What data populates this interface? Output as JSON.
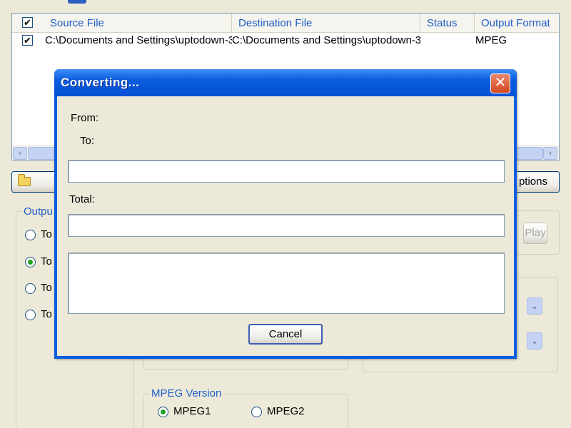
{
  "file_list": {
    "headers": [
      "Source File",
      "Destination File",
      "Status",
      "Output Format"
    ],
    "rows": [
      {
        "checked": true,
        "source": "C:\\Documents and Settings\\uptodown-3",
        "destination": "C:\\Documents and Settings\\uptodown-3",
        "status": "",
        "format": "MPEG"
      }
    ]
  },
  "toolbar": {
    "options_label": "ptions"
  },
  "output_group": {
    "label": "Outpu",
    "options": [
      "To",
      "To",
      "To",
      "To"
    ],
    "selected_index": 1
  },
  "play_button": "Play",
  "mpeg_version": {
    "label": "MPEG Version",
    "options": [
      "MPEG1",
      "MPEG2"
    ],
    "selected": "MPEG1"
  },
  "dialog": {
    "title": "Converting...",
    "from_label": "From:",
    "to_label": "To:",
    "total_label": "Total:",
    "cancel_label": "Cancel",
    "close_glyph": "✕"
  },
  "icons": {
    "scroll_left": "‹",
    "scroll_right": "›",
    "combo_arrow": "⌄"
  },
  "colors": {
    "window_bg": "#ECE9D8",
    "titlebar_blue": "#0A5CDF",
    "header_text": "#1F5EC9",
    "close_red": "#D5471E"
  }
}
